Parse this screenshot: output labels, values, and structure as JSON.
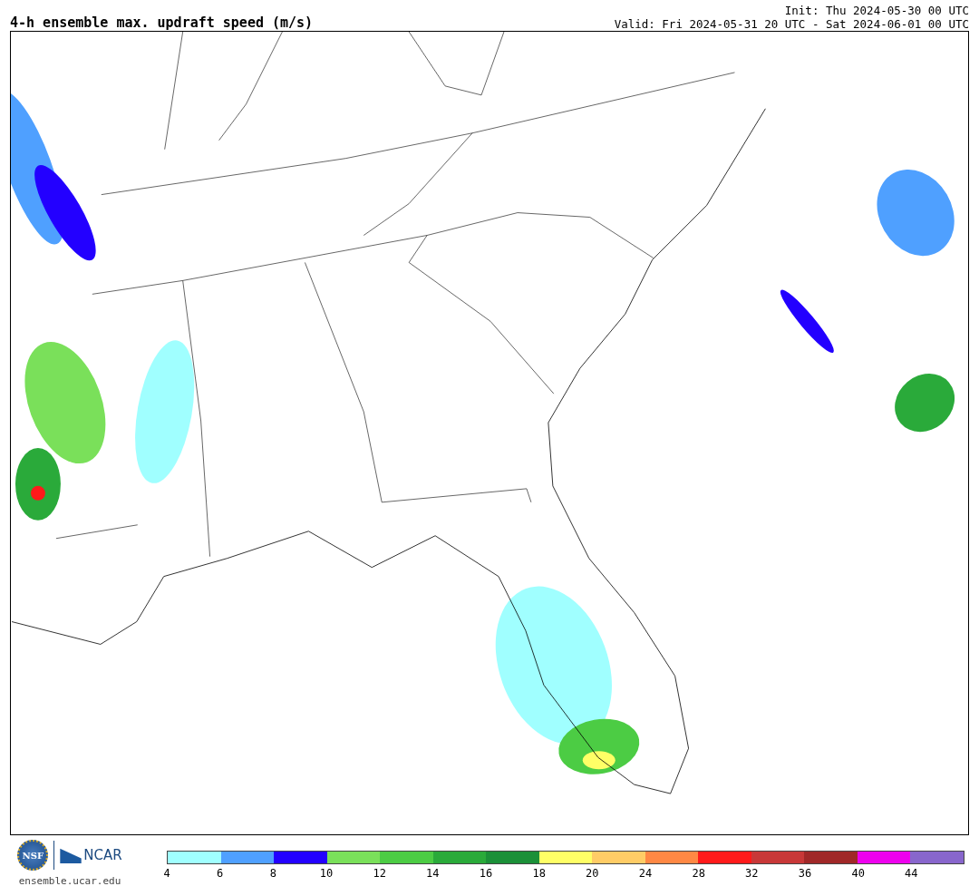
{
  "title": "4-h ensemble max. updraft speed (m/s)",
  "init": "Init: Thu 2024-05-30 00 UTC",
  "valid": "Valid: Fri 2024-05-31 20 UTC - Sat 2024-06-01 00 UTC",
  "footer": {
    "logo_left": "NSF",
    "logo_right": "NCAR",
    "url": "ensemble.ucar.edu"
  },
  "colorbar": {
    "bins": [
      {
        "color": "#a0ffff"
      },
      {
        "color": "#4fa0ff"
      },
      {
        "color": "#2300ff"
      },
      {
        "color": "#7ae05a"
      },
      {
        "color": "#4ccc44"
      },
      {
        "color": "#2aaa3a"
      },
      {
        "color": "#1b9038"
      },
      {
        "color": "#ffff66"
      },
      {
        "color": "#ffcc66"
      },
      {
        "color": "#ff8844"
      },
      {
        "color": "#ff1a1a"
      },
      {
        "color": "#c83838"
      },
      {
        "color": "#a02828"
      },
      {
        "color": "#ee00ee"
      },
      {
        "color": "#8866cc"
      }
    ],
    "ticks": [
      "4",
      "6",
      "8",
      "10",
      "12",
      "14",
      "16",
      "18",
      "20",
      "24",
      "28",
      "32",
      "36",
      "40",
      "44"
    ]
  }
}
